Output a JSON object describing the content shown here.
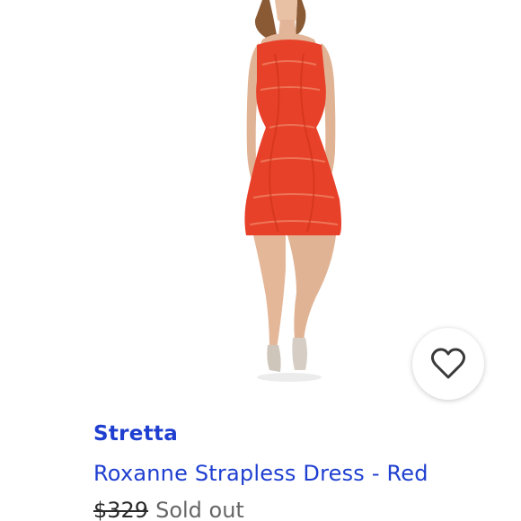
{
  "product": {
    "brand": "Stretta",
    "title": "Roxanne Strapless Dress - Red",
    "original_price": "$329",
    "status": "Sold out"
  },
  "image": {
    "subject": "model wearing red strapless dress",
    "dress_color": "#e8412a"
  },
  "favorite": {
    "icon": "heart-outline-icon"
  },
  "colors": {
    "accent": "#1f3fd0",
    "price": "#2b2b2b",
    "muted": "#666666",
    "icon": "#3a3a3a"
  }
}
